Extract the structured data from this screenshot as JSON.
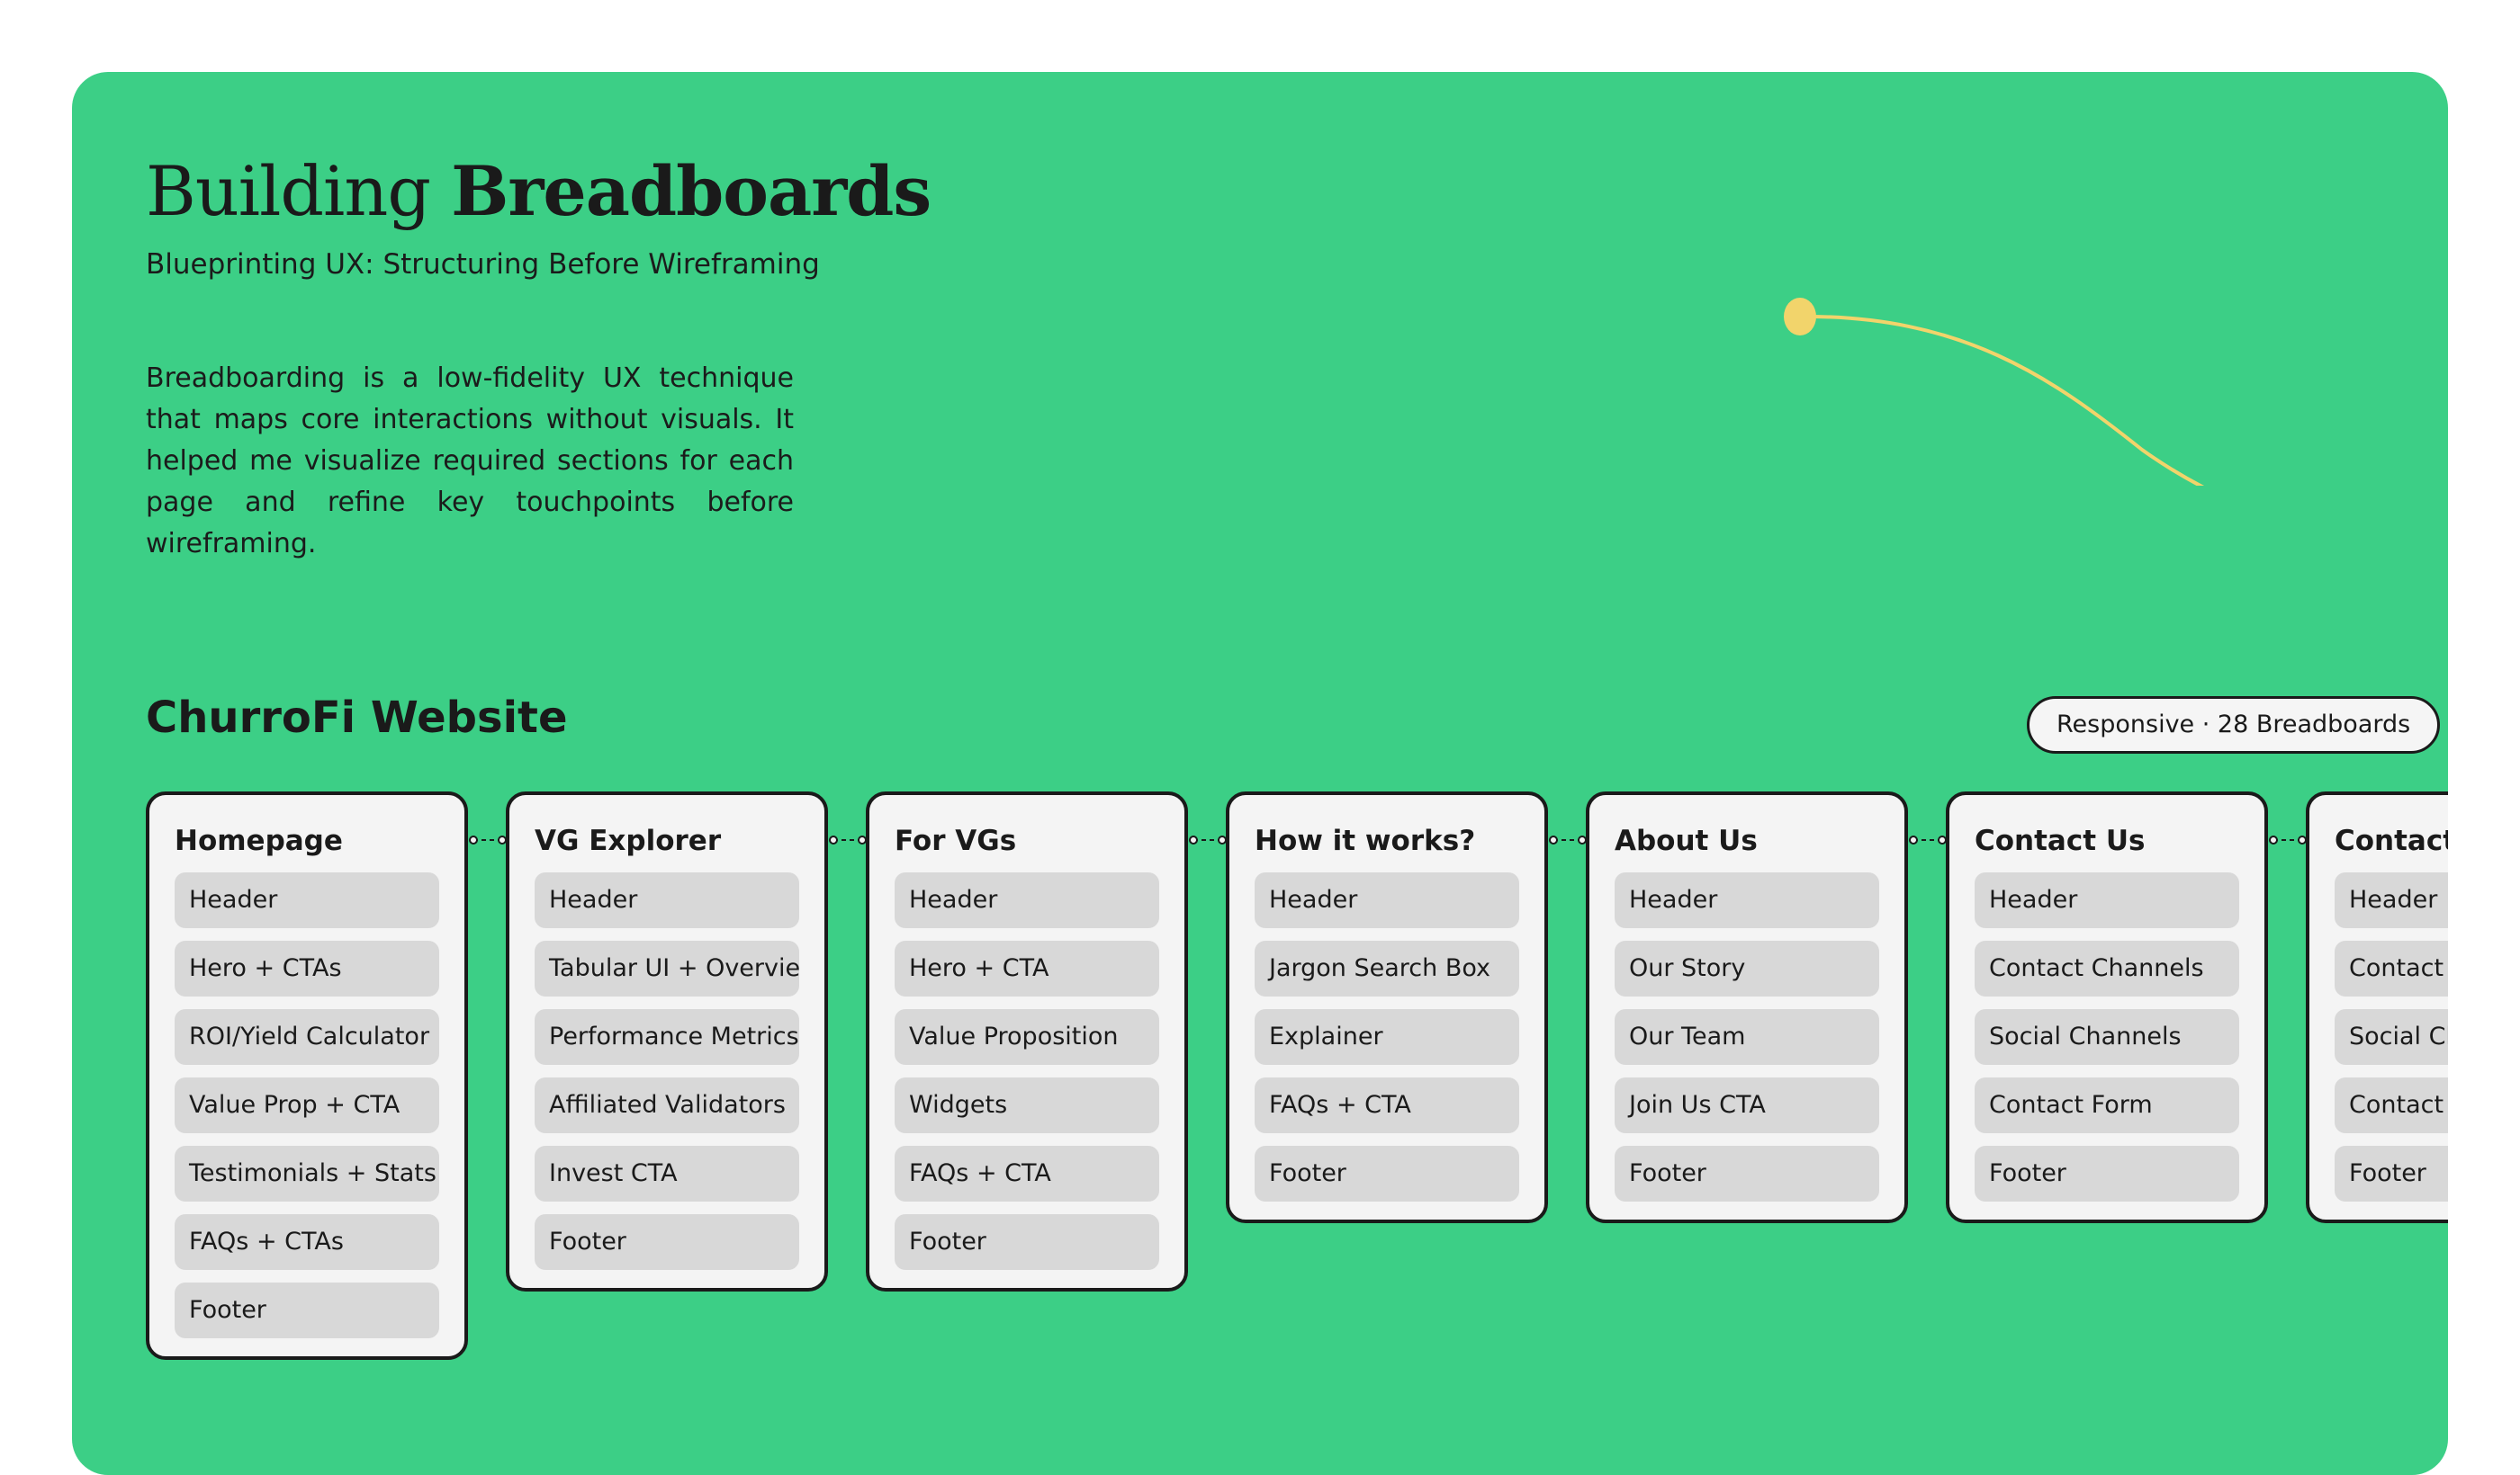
{
  "header": {
    "title_light": "Building",
    "title_bold": "Breadboards",
    "subtitle": "Blueprinting UX: Structuring Before Wireframing",
    "description": "Breadboarding is a low-fidelity UX technique that maps core interactions without visuals. It helped me visualize required sections for each page and refine key touchpoints before wireframing."
  },
  "section": {
    "title": "ChurroFi Website",
    "badge": "Responsive · 28 Breadboards"
  },
  "colors": {
    "background": "#3ccf86",
    "accent_curve": "#f2d46b",
    "card": "#f4f4f4",
    "chip": "#d8d8d8",
    "ink": "#1a1a1a"
  },
  "cards": [
    {
      "title": "Homepage",
      "items": [
        "Header",
        "Hero + CTAs",
        "ROI/Yield Calculator",
        "Value Prop + CTA",
        "Testimonials + Stats",
        "FAQs + CTAs",
        "Footer"
      ]
    },
    {
      "title": "VG Explorer",
      "items": [
        "Header",
        "Tabular UI + Overview",
        "Performance Metrics",
        "Affiliated Validators",
        "Invest CTA",
        "Footer"
      ]
    },
    {
      "title": "For VGs",
      "items": [
        "Header",
        "Hero + CTA",
        "Value Proposition",
        "Widgets",
        "FAQs + CTA",
        "Footer"
      ]
    },
    {
      "title": "How it works?",
      "items": [
        "Header",
        "Jargon Search Box",
        "Explainer",
        "FAQs + CTA",
        "Footer"
      ]
    },
    {
      "title": "About Us",
      "items": [
        "Header",
        "Our Story",
        "Our Team",
        "Join Us CTA",
        "Footer"
      ]
    },
    {
      "title": "Contact Us",
      "items": [
        "Header",
        "Contact Channels",
        "Social Channels",
        "Contact Form",
        "Footer"
      ]
    },
    {
      "title": "Contact Us",
      "items": [
        "Header",
        "Contact Channels",
        "Social Channels",
        "Contact Form",
        "Footer"
      ]
    }
  ]
}
